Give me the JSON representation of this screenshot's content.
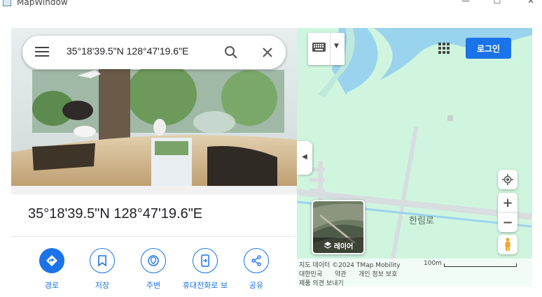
{
  "window": {
    "title": "MapWindow",
    "minimize": "—",
    "maximize": "☐",
    "close": "✕"
  },
  "search": {
    "value": "35°18'39.5\"N 128°47'19.6\"E"
  },
  "place": {
    "title": "35°18'39.5\"N 128°47'19.6\"E"
  },
  "actions": [
    {
      "label": "경로",
      "icon": "directions-icon"
    },
    {
      "label": "저장",
      "icon": "bookmark-icon"
    },
    {
      "label": "주변",
      "icon": "nearby-icon"
    },
    {
      "label": "휴대전화로 보",
      "icon": "send-to-phone-icon"
    },
    {
      "label": "공유",
      "icon": "share-icon"
    }
  ],
  "map": {
    "login_label": "로그인",
    "layer_label": "레이어",
    "road_label": "한림로",
    "attribution": {
      "data": "지도 데이터 ©2024 TMap Mobility",
      "country": "대한민국",
      "terms": "약관",
      "privacy": "개인 정보 보호",
      "feedback": "제품 의견 보내기",
      "scale": "100m"
    }
  },
  "colors": {
    "accent": "#1a73e8",
    "map_bg": "#cff5df",
    "water": "#9ad3ee",
    "road": "#d8dde0"
  }
}
